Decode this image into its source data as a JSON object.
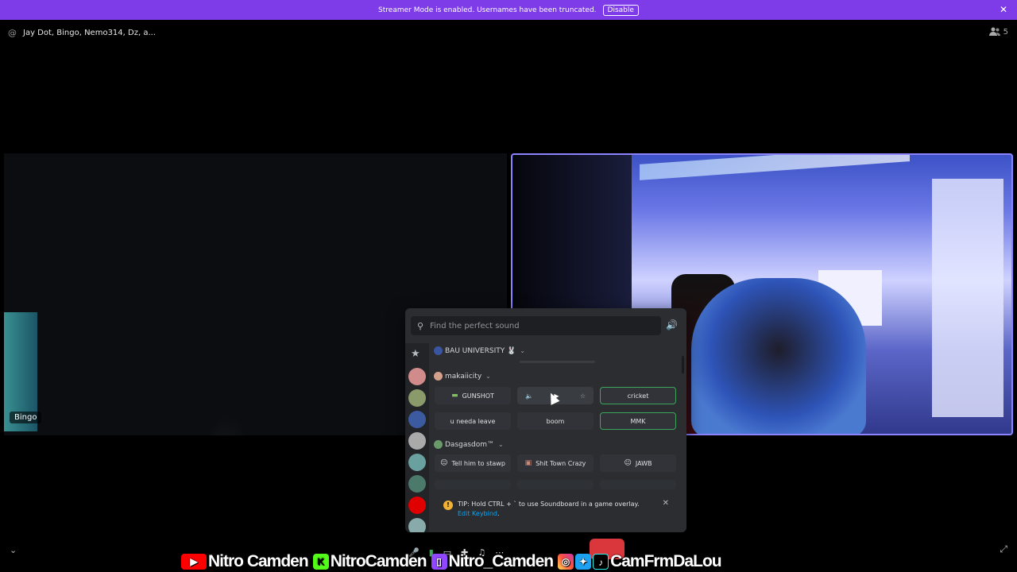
{
  "banner": {
    "text": "Streamer Mode is enabled. Usernames have been truncated.",
    "button": "Disable",
    "close": "✕"
  },
  "call": {
    "title": "Jay Dot, Bingo, Nemo314, Dz, a...",
    "member_count": "5"
  },
  "tiles": {
    "left_name": "Bingo"
  },
  "soundboard": {
    "search_placeholder": "Find the perfect sound",
    "sections": [
      {
        "name": "BAU UNIVERSITY 🐰"
      },
      {
        "name": "makaiicity"
      },
      {
        "name": "Dasgasdom™"
      }
    ],
    "sounds": {
      "gunshot": "GUNSHOT",
      "cricket": "cricket",
      "u_needa_leave": "u needa leave",
      "boom": "boom",
      "mmk": "MMK",
      "tell_him": "Tell him to stawp",
      "shit_town": "Shit Town Crazy",
      "jawb": "JAWB"
    },
    "tip": {
      "text": "TIP: Hold CTRL + ` to use Soundboard in a game overlay.",
      "link1": "Edit",
      "link2": "Keybind",
      "link_tail": "."
    }
  },
  "overlay": {
    "youtube": "Nitro Camden",
    "kick": "NitroCamden",
    "twitch": "Nitro_Camden",
    "handle": "CamFrmDaLou"
  },
  "colors": {
    "banner": "#7d3ce8",
    "accent_border": "#8b83ff",
    "highlight_green": "#3ba55c",
    "hangup": "#da373c"
  }
}
